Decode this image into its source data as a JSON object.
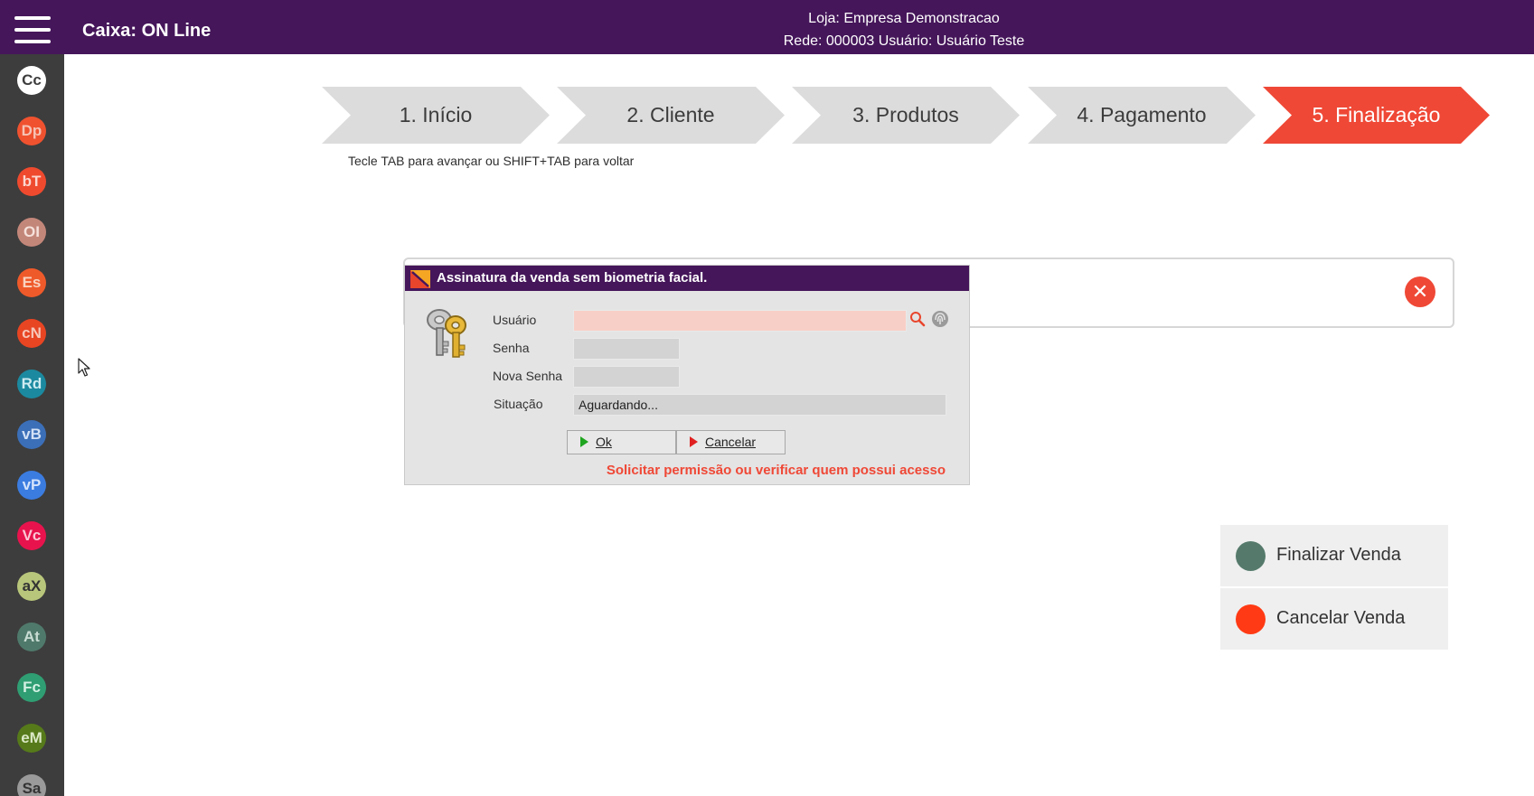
{
  "header": {
    "app_title": "Caixa: ON Line",
    "store_line": "Loja: Empresa Demonstracao",
    "network_line": "Rede: 000003 Usuário: Usuário Teste"
  },
  "sidebar": {
    "items": [
      {
        "label": "Cc",
        "color": "#ffffff",
        "text_color": "#3d3d3d"
      },
      {
        "label": "Dp",
        "color": "#f0522f",
        "text_color": "#f6c3b5"
      },
      {
        "label": "bT",
        "color": "#ef4a2e",
        "text_color": "#fbd6cf"
      },
      {
        "label": "OI",
        "color": "#c3877a",
        "text_color": "#f5e1db"
      },
      {
        "label": "Es",
        "color": "#ef5a2a",
        "text_color": "#f9d3c0"
      },
      {
        "label": "cN",
        "color": "#e84523",
        "text_color": "#f6c6b8"
      },
      {
        "label": "Rd",
        "color": "#1b8aa0",
        "text_color": "#cdebf1"
      },
      {
        "label": "vB",
        "color": "#3b6fb8",
        "text_color": "#d4e1f5"
      },
      {
        "label": "vP",
        "color": "#3b7ce0",
        "text_color": "#d4e3fb"
      },
      {
        "label": "Vc",
        "color": "#e8134d",
        "text_color": "#fbc7d5"
      },
      {
        "label": "aX",
        "color": "#b8c67b",
        "text_color": "#333333"
      },
      {
        "label": "At",
        "color": "#4f7a6b",
        "text_color": "#c9dcd4"
      },
      {
        "label": "Fc",
        "color": "#2f9e72",
        "text_color": "#d2f0e3"
      },
      {
        "label": "eM",
        "color": "#567a1a",
        "text_color": "#dbe9c6"
      },
      {
        "label": "Sa",
        "color": "#9a9a9a",
        "text_color": "#333333"
      }
    ]
  },
  "wizard": {
    "steps": [
      {
        "label": "1. Início"
      },
      {
        "label": "2. Cliente"
      },
      {
        "label": "3. Produtos"
      },
      {
        "label": "4. Pagamento"
      },
      {
        "label": "5. Finalização",
        "active": true
      }
    ],
    "hint": "Tecle TAB para avançar ou SHIFT+TAB para voltar"
  },
  "dialog": {
    "title": "Assinatura da venda sem biometria facial.",
    "fields": {
      "user_label": "Usuário",
      "user_value": "",
      "password_label": "Senha",
      "new_password_label": "Nova Senha",
      "status_label": "Situação",
      "status_value": "Aguardando..."
    },
    "ok_label": "Ok",
    "cancel_label": "Cancelar",
    "permission_link": "Solicitar permissão ou verificar quem possui acesso"
  },
  "actions": {
    "finalize_label": "Finalizar Venda",
    "finalize_color": "#557a6b",
    "cancel_label": "Cancelar Venda",
    "cancel_color": "#ff3a14"
  },
  "colors": {
    "header_bg": "#45165a",
    "sidebar_bg": "#3d3d3d",
    "accent": "#ef4836"
  }
}
